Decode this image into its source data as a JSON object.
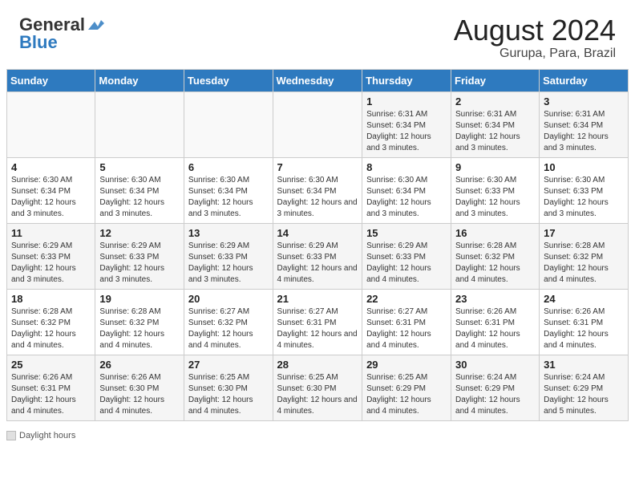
{
  "header": {
    "logo_general": "General",
    "logo_blue": "Blue",
    "title": "August 2024",
    "subtitle": "Gurupa, Para, Brazil"
  },
  "days_of_week": [
    "Sunday",
    "Monday",
    "Tuesday",
    "Wednesday",
    "Thursday",
    "Friday",
    "Saturday"
  ],
  "weeks": [
    [
      {
        "day": "",
        "info": ""
      },
      {
        "day": "",
        "info": ""
      },
      {
        "day": "",
        "info": ""
      },
      {
        "day": "",
        "info": ""
      },
      {
        "day": "1",
        "info": "Sunrise: 6:31 AM\nSunset: 6:34 PM\nDaylight: 12 hours and 3 minutes."
      },
      {
        "day": "2",
        "info": "Sunrise: 6:31 AM\nSunset: 6:34 PM\nDaylight: 12 hours and 3 minutes."
      },
      {
        "day": "3",
        "info": "Sunrise: 6:31 AM\nSunset: 6:34 PM\nDaylight: 12 hours and 3 minutes."
      }
    ],
    [
      {
        "day": "4",
        "info": "Sunrise: 6:30 AM\nSunset: 6:34 PM\nDaylight: 12 hours and 3 minutes."
      },
      {
        "day": "5",
        "info": "Sunrise: 6:30 AM\nSunset: 6:34 PM\nDaylight: 12 hours and 3 minutes."
      },
      {
        "day": "6",
        "info": "Sunrise: 6:30 AM\nSunset: 6:34 PM\nDaylight: 12 hours and 3 minutes."
      },
      {
        "day": "7",
        "info": "Sunrise: 6:30 AM\nSunset: 6:34 PM\nDaylight: 12 hours and 3 minutes."
      },
      {
        "day": "8",
        "info": "Sunrise: 6:30 AM\nSunset: 6:34 PM\nDaylight: 12 hours and 3 minutes."
      },
      {
        "day": "9",
        "info": "Sunrise: 6:30 AM\nSunset: 6:33 PM\nDaylight: 12 hours and 3 minutes."
      },
      {
        "day": "10",
        "info": "Sunrise: 6:30 AM\nSunset: 6:33 PM\nDaylight: 12 hours and 3 minutes."
      }
    ],
    [
      {
        "day": "11",
        "info": "Sunrise: 6:29 AM\nSunset: 6:33 PM\nDaylight: 12 hours and 3 minutes."
      },
      {
        "day": "12",
        "info": "Sunrise: 6:29 AM\nSunset: 6:33 PM\nDaylight: 12 hours and 3 minutes."
      },
      {
        "day": "13",
        "info": "Sunrise: 6:29 AM\nSunset: 6:33 PM\nDaylight: 12 hours and 3 minutes."
      },
      {
        "day": "14",
        "info": "Sunrise: 6:29 AM\nSunset: 6:33 PM\nDaylight: 12 hours and 4 minutes."
      },
      {
        "day": "15",
        "info": "Sunrise: 6:29 AM\nSunset: 6:33 PM\nDaylight: 12 hours and 4 minutes."
      },
      {
        "day": "16",
        "info": "Sunrise: 6:28 AM\nSunset: 6:32 PM\nDaylight: 12 hours and 4 minutes."
      },
      {
        "day": "17",
        "info": "Sunrise: 6:28 AM\nSunset: 6:32 PM\nDaylight: 12 hours and 4 minutes."
      }
    ],
    [
      {
        "day": "18",
        "info": "Sunrise: 6:28 AM\nSunset: 6:32 PM\nDaylight: 12 hours and 4 minutes."
      },
      {
        "day": "19",
        "info": "Sunrise: 6:28 AM\nSunset: 6:32 PM\nDaylight: 12 hours and 4 minutes."
      },
      {
        "day": "20",
        "info": "Sunrise: 6:27 AM\nSunset: 6:32 PM\nDaylight: 12 hours and 4 minutes."
      },
      {
        "day": "21",
        "info": "Sunrise: 6:27 AM\nSunset: 6:31 PM\nDaylight: 12 hours and 4 minutes."
      },
      {
        "day": "22",
        "info": "Sunrise: 6:27 AM\nSunset: 6:31 PM\nDaylight: 12 hours and 4 minutes."
      },
      {
        "day": "23",
        "info": "Sunrise: 6:26 AM\nSunset: 6:31 PM\nDaylight: 12 hours and 4 minutes."
      },
      {
        "day": "24",
        "info": "Sunrise: 6:26 AM\nSunset: 6:31 PM\nDaylight: 12 hours and 4 minutes."
      }
    ],
    [
      {
        "day": "25",
        "info": "Sunrise: 6:26 AM\nSunset: 6:31 PM\nDaylight: 12 hours and 4 minutes."
      },
      {
        "day": "26",
        "info": "Sunrise: 6:26 AM\nSunset: 6:30 PM\nDaylight: 12 hours and 4 minutes."
      },
      {
        "day": "27",
        "info": "Sunrise: 6:25 AM\nSunset: 6:30 PM\nDaylight: 12 hours and 4 minutes."
      },
      {
        "day": "28",
        "info": "Sunrise: 6:25 AM\nSunset: 6:30 PM\nDaylight: 12 hours and 4 minutes."
      },
      {
        "day": "29",
        "info": "Sunrise: 6:25 AM\nSunset: 6:29 PM\nDaylight: 12 hours and 4 minutes."
      },
      {
        "day": "30",
        "info": "Sunrise: 6:24 AM\nSunset: 6:29 PM\nDaylight: 12 hours and 4 minutes."
      },
      {
        "day": "31",
        "info": "Sunrise: 6:24 AM\nSunset: 6:29 PM\nDaylight: 12 hours and 5 minutes."
      }
    ]
  ],
  "footer": {
    "daylight_hours_label": "Daylight hours"
  }
}
